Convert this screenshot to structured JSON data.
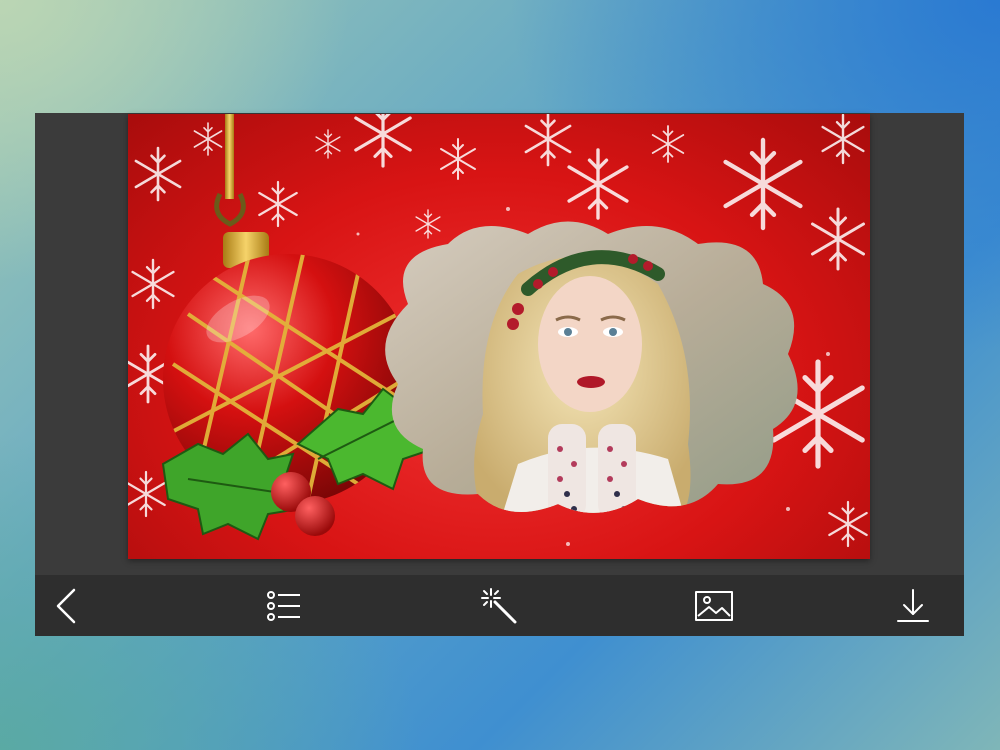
{
  "editor": {
    "frame_theme": "christmas-ornament-snowflake-frame",
    "colors": {
      "frame_red": "#d81414",
      "toolbar_bg": "#2e2e2e",
      "panel_bg": "#3b3b3b",
      "icon_color": "#ffffff",
      "ornament_gold": "#e2b43a",
      "holly_green": "#3fa52a"
    }
  },
  "toolbar": {
    "items": [
      {
        "name": "back",
        "icon": "chevron-left-icon"
      },
      {
        "name": "frames",
        "icon": "list-icon"
      },
      {
        "name": "effects",
        "icon": "magic-wand-icon"
      },
      {
        "name": "gallery",
        "icon": "image-icon"
      },
      {
        "name": "save",
        "icon": "download-icon"
      }
    ]
  }
}
